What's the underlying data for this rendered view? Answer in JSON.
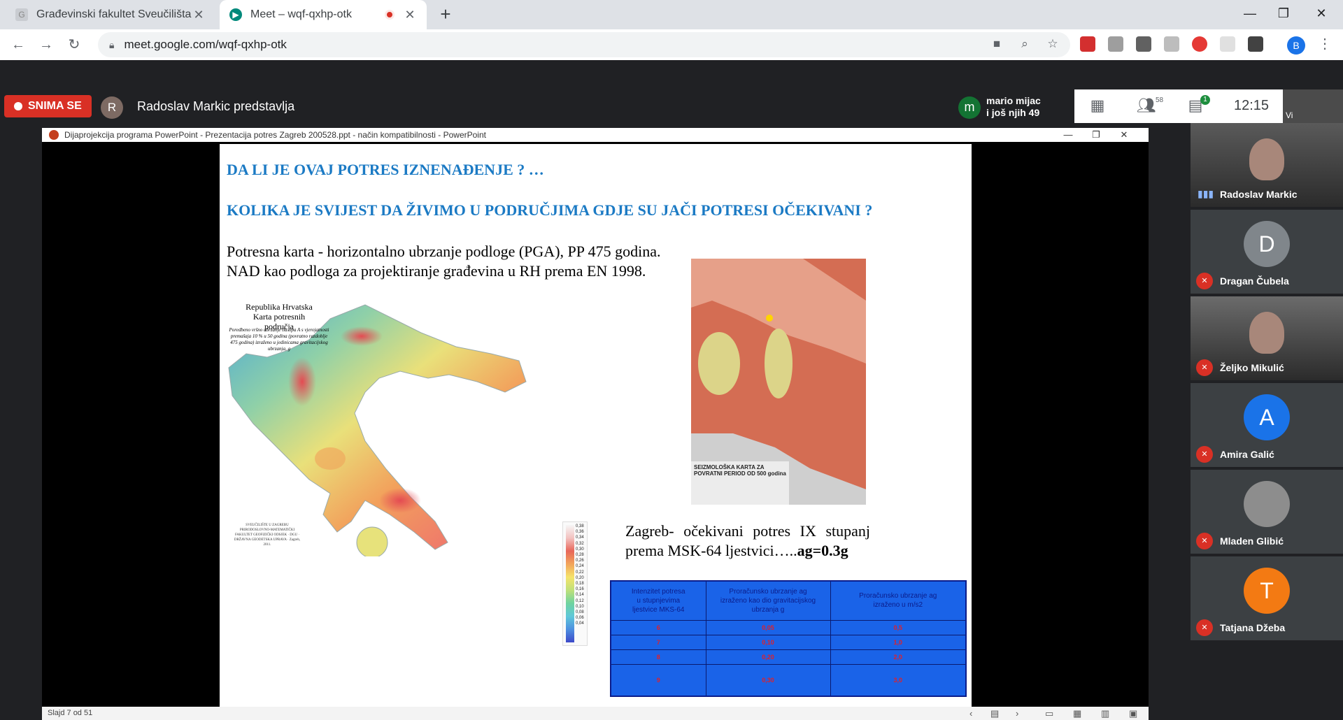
{
  "browser": {
    "tabs": [
      {
        "title": "Građevinski fakultet Sveučilišta u",
        "active": false
      },
      {
        "title": "Meet – wqf-qxhp-otk",
        "active": true
      }
    ],
    "url": "meet.google.com/wqf-qxhp-otk",
    "profile_initial": "B"
  },
  "meet": {
    "recording_label": "SNIMA SE",
    "presenter_initial": "R",
    "presenter_text": "Radoslav Markic predstavlja",
    "joined_initial": "m",
    "joined_name": "mario mijac",
    "joined_more": "i još njih 49",
    "participants_count": "58",
    "chat_badge": "1",
    "clock": "12:15",
    "self_label": "Vi"
  },
  "ppt": {
    "window_title": "Dijaprojekcija programa PowerPoint  -  Prezentacija potres Zagreb 200528.ppt  -  način kompatibilnosti - PowerPoint",
    "status_slide": "Slajd 7 od 51",
    "slide": {
      "heading1": "DA LI JE OVAJ POTRES IZNENAĐENJE ? …",
      "heading2": "KOLIKA JE SVIJEST DA ŽIVIMO U PODRUČJIMA GDJE SU JAČI POTRESI OČEKIVANI ?",
      "body_line1": "Potresna karta -  horizontalno ubrzanje podloge (PGA), PP 475 godina.",
      "body_line2": "NAD kao podloga za projektiranje građevina u RH prema EN 1998.",
      "map_title": "Republika Hrvatska\nKarta potresnih područja",
      "map_subtitle": "Poredbeno vršno ubrzanje tla tipa A s vjerojatnosti premašaja 10 % u 50 godina (povratno razdoblje 475 godina) izraženo u jedinicama gravitacijskog ubrzanja, g",
      "map_legend_values": [
        "0,38",
        "0,36",
        "0,34",
        "0,32",
        "0,30",
        "0,28",
        "0,26",
        "0,24",
        "0,22",
        "0,20",
        "0,18",
        "0,16",
        "0,14",
        "0,12",
        "0,10",
        "0,08",
        "0,06",
        "0,04"
      ],
      "map_credits": "SVEUČILIŠTE U ZAGREBU PRIRODOSLOVNO-MATEMATIČKI FAKULTET GEOFIZIČKI ODSJEK · DGU · DRŽAVNA GEODETSKA UPRAVA · Zagreb, 2011.",
      "seis_map_label": "SEIZMOLOŠKA KARTA ZA POVRATNI PERIOD OD 500 godina",
      "zagreb_text_main": "Zagreb- očekivani potres IX stupanj prema MSK-64 ljestvici…..",
      "zagreb_text_bold": "ag=0.3g",
      "table": {
        "headers": [
          "Intenzitet potresa\nu stupnjevima\nljestvice MKS-64",
          "Proračunsko ubrzanje ag\nizraženo kao dio gravitacijskog\nubrzanja g",
          "Proračunsko ubrzanje ag\nizraženo u m/s2"
        ],
        "rows": [
          [
            "6",
            "0,05",
            "0,5"
          ],
          [
            "7",
            "0,10",
            "1,0"
          ],
          [
            "8",
            "0,20",
            "2,0"
          ],
          [
            "9",
            "0,30",
            "3,0"
          ]
        ]
      }
    }
  },
  "participants": [
    {
      "name": "Radoslav Markic",
      "initial": "",
      "color": "#5a5a5a",
      "video": true,
      "muted": false
    },
    {
      "name": "Dragan Čubela",
      "initial": "D",
      "color": "#80868b",
      "video": false,
      "muted": true
    },
    {
      "name": "Željko Mikulić",
      "initial": "",
      "color": "#6b6b6b",
      "video": true,
      "muted": true
    },
    {
      "name": "Amira Galić",
      "initial": "A",
      "color": "#1a73e8",
      "video": false,
      "muted": true
    },
    {
      "name": "Mladen Glibić",
      "initial": "",
      "color": "#8d8d8d",
      "video": false,
      "muted": true
    },
    {
      "name": "Tatjana Džeba",
      "initial": "T",
      "color": "#f37a13",
      "video": false,
      "muted": true
    }
  ]
}
